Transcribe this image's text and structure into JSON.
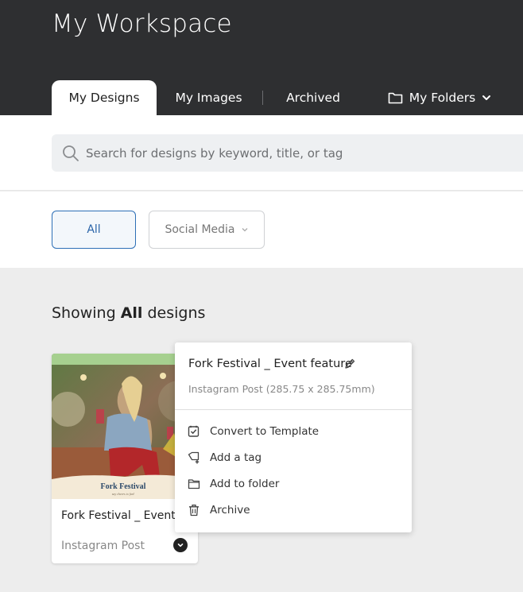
{
  "header": {
    "title": "My Workspace"
  },
  "tabs": [
    {
      "label": "My Designs"
    },
    {
      "label": "My Images"
    },
    {
      "label": "Archived"
    },
    {
      "label": "My Folders"
    }
  ],
  "search": {
    "placeholder": "Search for designs by keyword, title, or tag",
    "value": ""
  },
  "filters": {
    "all": "All",
    "social_media": "Social Media"
  },
  "showing": {
    "prefix": "Showing",
    "emphasis": "All",
    "suffix": "designs"
  },
  "card": {
    "title": "Fork Festival _ Event",
    "type": "Instagram Post",
    "thumb_brand": "Fork Festival",
    "thumb_tagline": "say cheers to fun!"
  },
  "popup": {
    "title": "Fork Festival _ Event feature",
    "subtitle": "Instagram Post (285.75 x 285.75mm)",
    "items": [
      {
        "label": "Convert to Template",
        "icon": "convert-template-icon"
      },
      {
        "label": "Add a tag",
        "icon": "add-tag-icon"
      },
      {
        "label": "Add to folder",
        "icon": "folder-icon"
      },
      {
        "label": "Archive",
        "icon": "trash-icon"
      }
    ]
  },
  "colors": {
    "header_bg": "#2e2f31",
    "accent": "#2d6fb6",
    "page_bg": "#ededed"
  }
}
